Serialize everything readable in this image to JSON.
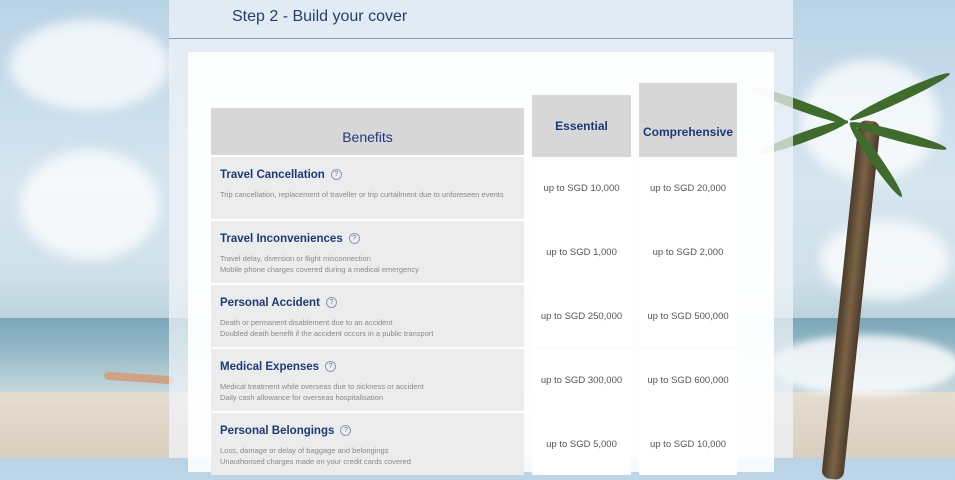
{
  "step": {
    "title": "Step 2 - Build your cover"
  },
  "table": {
    "headers": {
      "benefits": "Benefits",
      "essential": "Essential",
      "comprehensive": "Comprehensive"
    },
    "rows": [
      {
        "title": "Travel Cancellation",
        "desc1": "Trip cancellation, replacement of traveller or trip curtailment due to unforeseen events",
        "desc2": "",
        "essential": "up to SGD 10,000",
        "comprehensive": "up to SGD 20,000"
      },
      {
        "title": "Travel Inconveniences",
        "desc1": "Travel delay, diversion or flight misconnection",
        "desc2": "Mobile phone charges covered during a medical emergency",
        "essential": "up to SGD 1,000",
        "comprehensive": "up to SGD 2,000"
      },
      {
        "title": "Personal Accident",
        "desc1": "Death or permanent disablement due to an accident",
        "desc2": "Doubled death benefit if the accident occurs in a public transport",
        "essential": "up to SGD 250,000",
        "comprehensive": "up to SGD 500,000"
      },
      {
        "title": "Medical Expenses",
        "desc1": "Medical treatment while overseas due to sickness or accident",
        "desc2": "Daily cash allowance for overseas hospitalisation",
        "essential": "up to SGD 300,000",
        "comprehensive": "up to SGD 600,000"
      },
      {
        "title": "Personal Belongings",
        "desc1": "Loss, damage or delay of baggage and belongings",
        "desc2": "Unauthorised charges made on your credit cards covered",
        "essential": "up to SGD 5,000",
        "comprehensive": "up to SGD 10,000"
      }
    ]
  },
  "icons": {
    "help": "help-icon",
    "help_glyph": "?"
  },
  "colors": {
    "heading_blue": "#1c3a7a",
    "header_grey": "#d7d7d7",
    "row_grey": "#ececec"
  }
}
